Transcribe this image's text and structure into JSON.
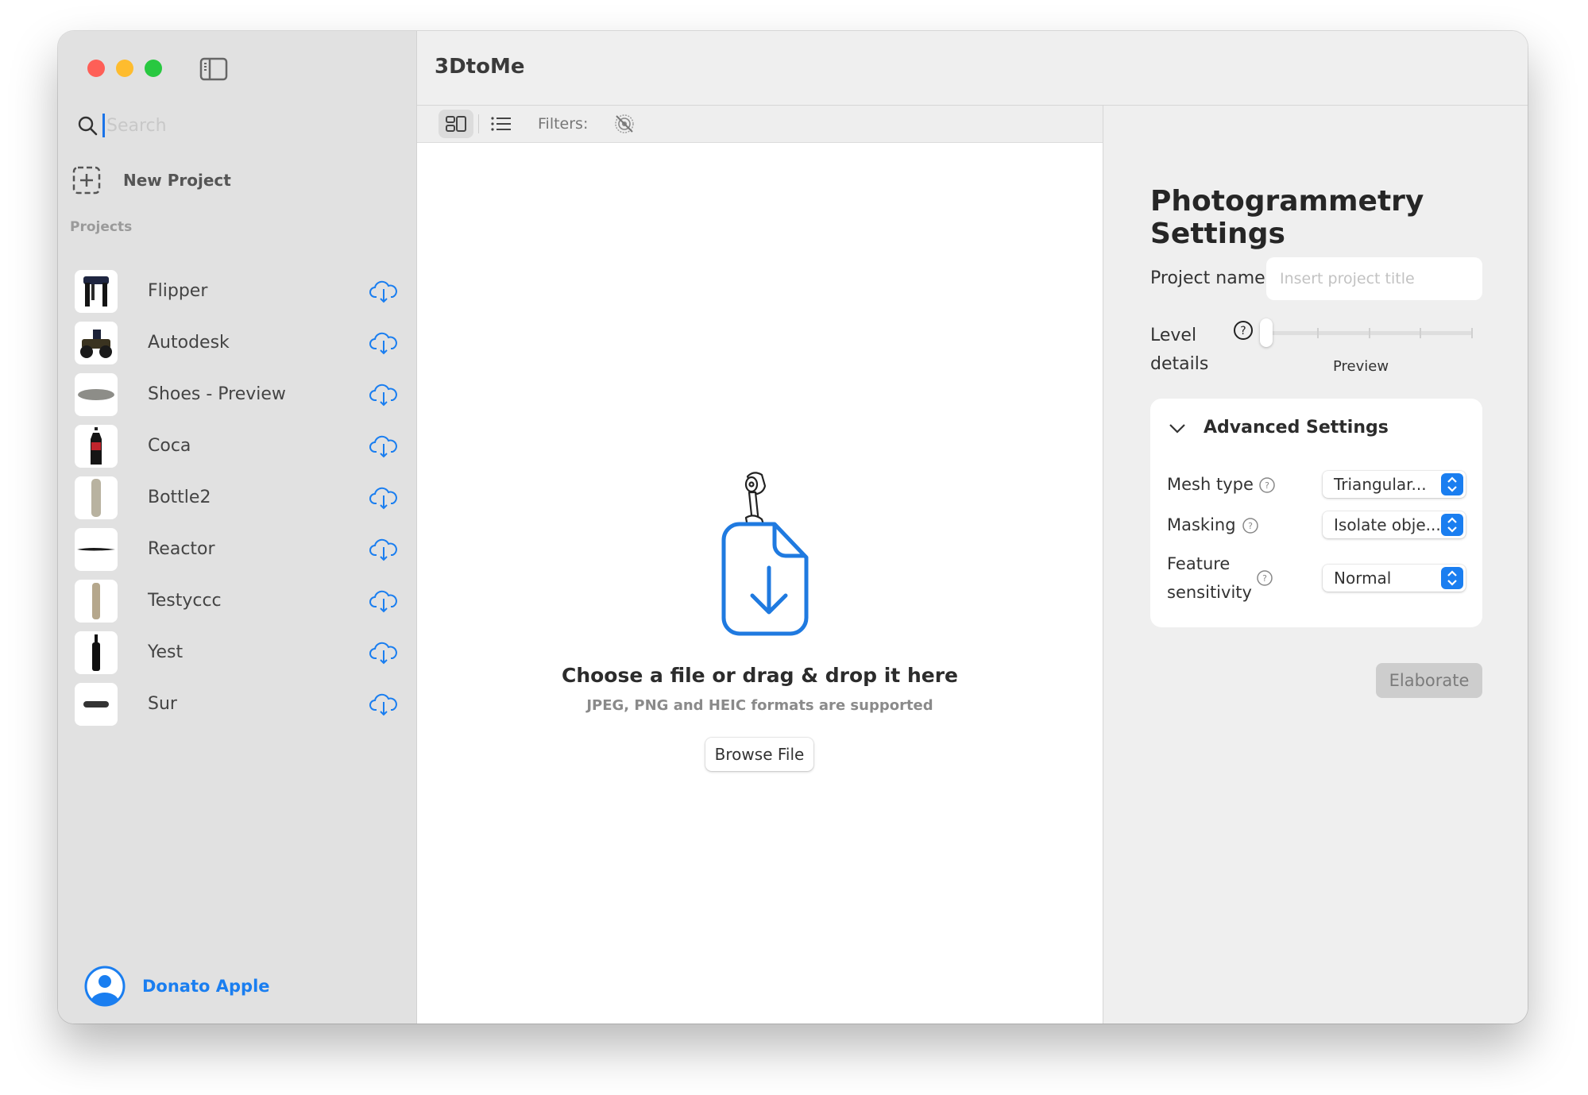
{
  "window": {
    "title": "3DtoMe"
  },
  "sidebar": {
    "search_placeholder": "Search",
    "new_project_label": "New Project",
    "projects_header": "Projects",
    "projects": [
      {
        "name": "Flipper",
        "thumbnail": "robot-frame"
      },
      {
        "name": "Autodesk",
        "thumbnail": "atv-vehicle"
      },
      {
        "name": "Shoes - Preview",
        "thumbnail": "shoe"
      },
      {
        "name": "Coca",
        "thumbnail": "cola-bottle"
      },
      {
        "name": "Bottle2",
        "thumbnail": "clear-bottle"
      },
      {
        "name": "Reactor",
        "thumbnail": "flat-blade"
      },
      {
        "name": "Testyccc",
        "thumbnail": "beige-cylinder"
      },
      {
        "name": "Yest",
        "thumbnail": "black-bottle"
      },
      {
        "name": "Sur",
        "thumbnail": "dark-pad"
      }
    ],
    "item_action_icon": "cloud-download-icon",
    "user_name": "Donato Apple"
  },
  "toolbar": {
    "grid_view_icon": "grid-view-icon",
    "list_view_icon": "list-view-icon",
    "filters_label": "Filters:",
    "filters_icon": "filter-off-icon",
    "active_view": "grid"
  },
  "dropzone": {
    "title": "Choose a file or drag & drop it here",
    "subtitle": "JPEG, PNG and HEIC formats are supported",
    "browse_label": "Browse File"
  },
  "settings": {
    "title": "Photogrammetry Settings",
    "project_name_label": "Project name",
    "project_name_value": "",
    "project_name_placeholder": "Insert project title",
    "level_details_label_line1": "Level",
    "level_details_label_line2": "details",
    "level_details_steps": 5,
    "level_details_value_index": 0,
    "level_details_caption": "Preview",
    "advanced": {
      "title": "Advanced Settings",
      "expanded": true,
      "mesh_type_label": "Mesh type",
      "mesh_type_value": "Triangular...",
      "masking_label": "Masking",
      "masking_value": "Isolate obje...",
      "feature_label_line1": "Feature",
      "feature_label_line2": "sensitivity",
      "feature_value": "Normal"
    },
    "elaborate_label": "Elaborate"
  },
  "colors": {
    "accent": "#1a7ef0",
    "sidebar_bg": "#e1e1e1",
    "panel_bg": "#efefef",
    "close": "#fe5f57",
    "minimize": "#febc2e",
    "zoom": "#28c840"
  }
}
